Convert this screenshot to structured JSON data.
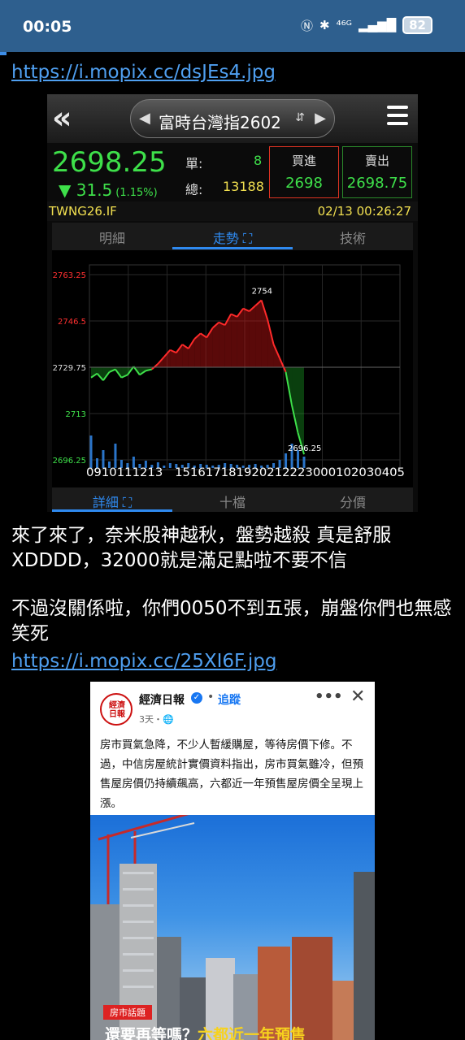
{
  "status": {
    "time": "00:05",
    "network": "⁴⁶ᴳ",
    "battery": "82"
  },
  "links": {
    "first": "https://i.mopix.cc/dsJEs4.jpg",
    "second": "https://i.mopix.cc/25XI6F.jpg"
  },
  "stock": {
    "title": "富時台灣指2602",
    "price": "2698.25",
    "change": "▼ 31.5",
    "change_pct": "(1.15%)",
    "single_label": "單:",
    "single_value": "8",
    "total_label": "總:",
    "total_value": "13188",
    "bid_label": "買進",
    "bid_value": "2698",
    "ask_label": "賣出",
    "ask_value": "2698.75",
    "symbol": "TWNG26.IF",
    "datetime": "02/13 00:26:27",
    "tabs": [
      "明細",
      "走勢 ⛶",
      "技術"
    ],
    "bottom_tabs": [
      "詳細 ⛶",
      "十檔",
      "分價"
    ],
    "colors": {
      "up": "#ff2a2a",
      "down": "#3ee04a",
      "accent": "#2f8af0",
      "info": "#f2e050"
    }
  },
  "chart_data": {
    "type": "line",
    "y_ticks": [
      "2763.25",
      "2746.5",
      "2729.75",
      "2713",
      "2696.25"
    ],
    "y_tick_values": [
      2763.25,
      2746.5,
      2729.75,
      2713,
      2696.25
    ],
    "x_ticks": "0910111213　151617181920212223000102030405",
    "ylim": [
      2696.25,
      2763.25
    ],
    "reference": 2729.75,
    "annotations": [
      {
        "text": "2754"
      },
      {
        "text": "2696.25"
      }
    ],
    "series": [
      {
        "values": [
          2726,
          2727.5,
          2725,
          2728,
          2729,
          2726,
          2727,
          2730,
          2727,
          2728.5,
          2729,
          2731,
          2733.5,
          2736,
          2735,
          2738,
          2736.5,
          2740,
          2742,
          2740.5,
          2744,
          2746,
          2745,
          2749,
          2748,
          2751,
          2750,
          2752,
          2754,
          2747,
          2738,
          2733,
          2728,
          2716,
          2706,
          2698.25
        ]
      }
    ]
  },
  "post": {
    "para1": "來了來了，奈米股神越秋，盤勢越殺 真是舒服XDDDD，32000就是滿足點啦不要不信",
    "para2": "不過沒關係啦，你們0050不到五張，崩盤你們也無感 笑死"
  },
  "news": {
    "logo_text": "經濟日報",
    "source": "經濟日報",
    "verified": "✓",
    "dot": "•",
    "follow": "追蹤",
    "time": "3天・🌐",
    "more": "•••",
    "close": "✕",
    "body": "房市買氣急降，不少人暫緩購屋，等待房價下修。不過，中信房屋統計實價資料指出，房市買氣雖冷，但預售屋房價仍持續飆高，六都近一年預售屋房價全呈現上漲。",
    "tag": "房市話題",
    "headline_white": "還要再等嗎？",
    "headline_yellow": "六都近一年預售"
  }
}
